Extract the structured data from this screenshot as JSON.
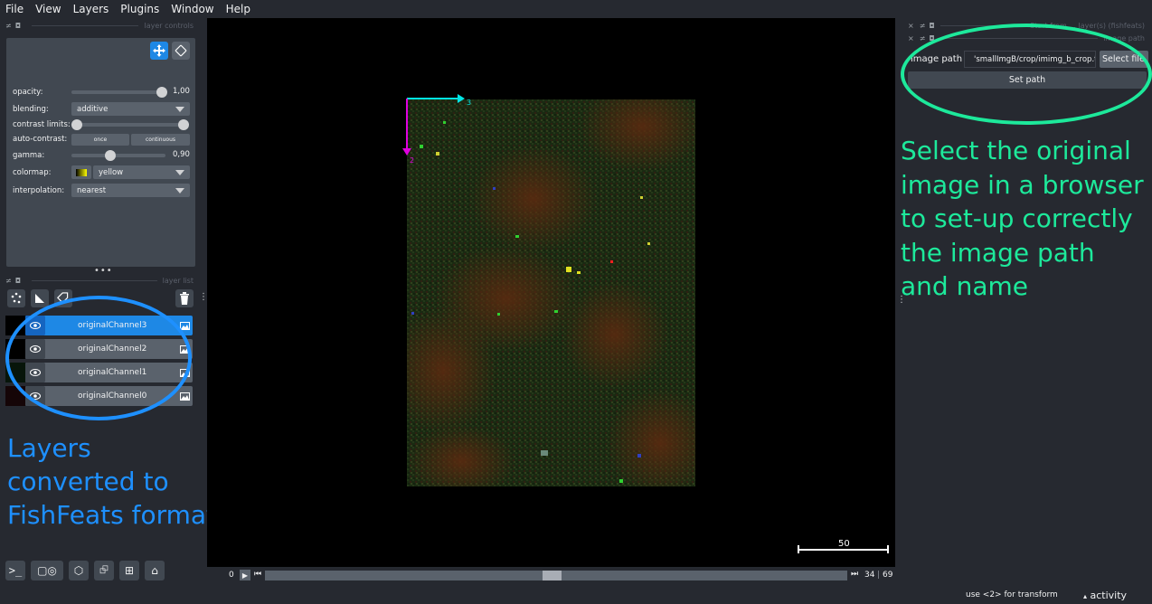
{
  "menu": [
    "File",
    "View",
    "Layers",
    "Plugins",
    "Window",
    "Help"
  ],
  "layer_controls": {
    "dock_title": "layer controls",
    "rows": {
      "opacity": {
        "label": "opacity:",
        "value": "1,00"
      },
      "blending": {
        "label": "blending:",
        "value": "additive"
      },
      "contrast_limits": {
        "label": "contrast limits:"
      },
      "auto_contrast": {
        "label": "auto-contrast:",
        "once": "once",
        "continuous": "continuous"
      },
      "gamma": {
        "label": "gamma:",
        "value": "0,90"
      },
      "colormap": {
        "label": "colormap:",
        "value": "yellow"
      },
      "interpolation": {
        "label": "interpolation:",
        "value": "nearest"
      }
    }
  },
  "layer_list": {
    "dock_title": "layer list",
    "layers": [
      {
        "name": "originalChannel3",
        "selected": true
      },
      {
        "name": "originalChannel2",
        "selected": false
      },
      {
        "name": "originalChannel1",
        "selected": false
      },
      {
        "name": "originalChannel0",
        "selected": false
      }
    ]
  },
  "annotations": {
    "left": "Layers converted to FishFeats format",
    "right": "Select the original image in a browser to set-up correctly the image path and name",
    "left_color": "#1e90ff",
    "right_color": "#1de99b"
  },
  "canvas": {
    "axis_x_label": "3",
    "axis_y_label": "2",
    "scalebar_label": "50"
  },
  "dims": {
    "axis_index": "0",
    "current": "34",
    "total": "69"
  },
  "right_panel": {
    "dock1_title": "Start from ... layer(s) (fishfeats)",
    "dock2_title": "image path",
    "image_path_label": "image path",
    "image_path_value": "'smallImgB/crop/imimg_b_crop.tif",
    "select_file": "Select file",
    "set_path": "Set path"
  },
  "status": {
    "hint": "use <2> for transform",
    "activity": "activity"
  }
}
